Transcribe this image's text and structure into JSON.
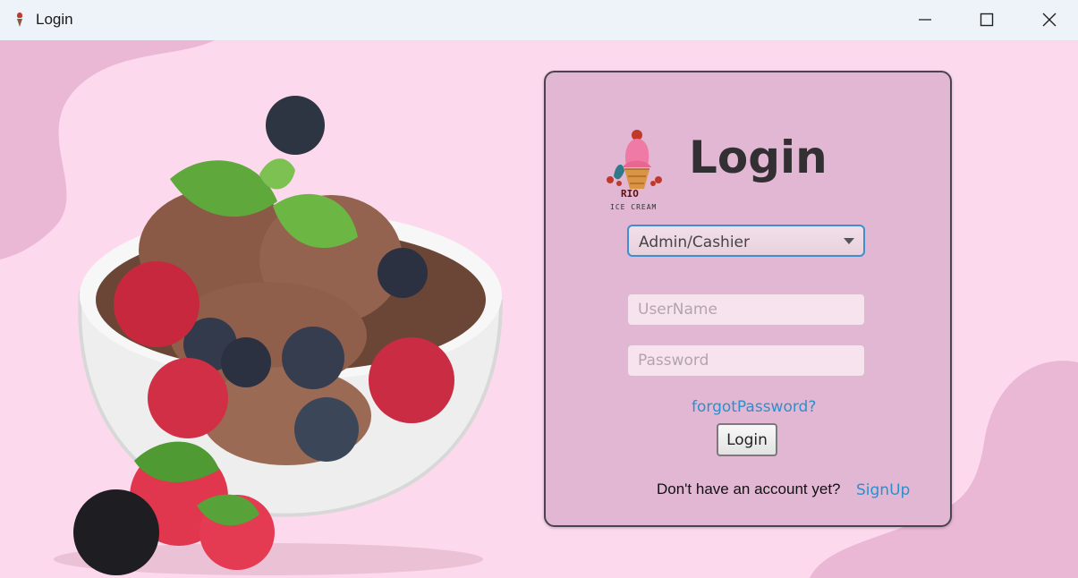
{
  "window": {
    "title": "Login",
    "controls": [
      "minimize",
      "maximize",
      "close"
    ]
  },
  "login": {
    "heading": "Login",
    "logo_text": "RIO",
    "logo_subtext": "ICE CREAM",
    "role_select": {
      "selected": "Admin/Cashier"
    },
    "username": {
      "placeholder": "UserName",
      "value": ""
    },
    "password": {
      "placeholder": "Password",
      "value": ""
    },
    "forgot_link": "forgotPassword?",
    "login_button": "Login",
    "no_account_text": "Don't have an account yet?",
    "signup_link": "SignUp"
  },
  "colors": {
    "background": "#fdd9ee",
    "blob": "#eab7d5",
    "card": "#e1b7d3",
    "link": "#2d8fcb",
    "focus_border": "#3d8fcf"
  }
}
